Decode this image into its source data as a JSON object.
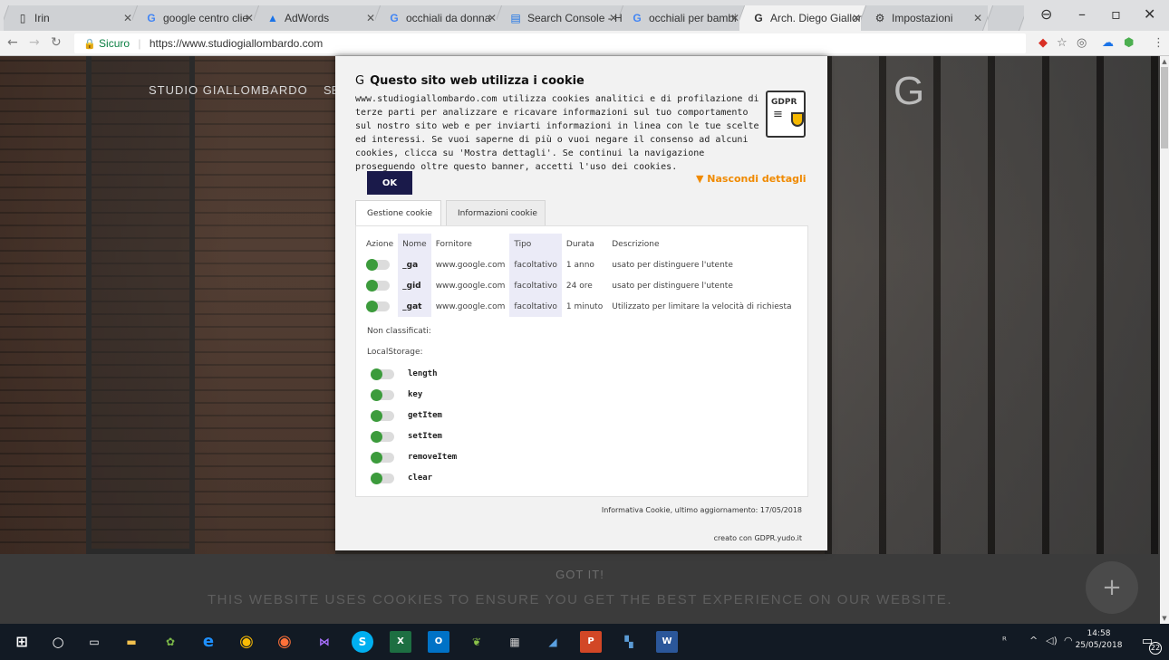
{
  "browser": {
    "tabs": [
      {
        "title": "Irin",
        "icon": "page-icon"
      },
      {
        "title": "google centro clie",
        "icon": "google-icon"
      },
      {
        "title": "AdWords",
        "icon": "adwords-icon"
      },
      {
        "title": "occhiali da donna",
        "icon": "google-icon"
      },
      {
        "title": "Search Console - H",
        "icon": "search-console-icon"
      },
      {
        "title": "occhiali per bambi",
        "icon": "google-icon"
      },
      {
        "title": "Arch. Diego Giallor",
        "icon": "g-icon",
        "active": true
      },
      {
        "title": "Impostazioni",
        "icon": "gear-icon"
      }
    ],
    "secure_label": "Sicuro",
    "url": "https://www.studiogiallombardo.com"
  },
  "site": {
    "brand": "STUDIO GIALLOMBARDO",
    "brand_fragment": "SE",
    "logo_letter": "G",
    "cookie_bar": {
      "got_it": "GOT IT!",
      "message": "THIS WEBSITE USES COOKIES TO ENSURE YOU GET THE BEST EXPERIENCE ON OUR WEBSITE."
    }
  },
  "gdpr": {
    "title": "Questo sito web utilizza i cookie",
    "logo_letter": "G",
    "body": "www.studiogiallombardo.com utilizza cookies analitici e di profilazione di terze parti per analizzare e ricavare informazioni sul tuo comportamento sul nostro sito web e per inviarti informazioni in linea con le tue scelte ed interessi. Se vuoi saperne di più o vuoi negare il consenso ad alcuni cookies, clicca su 'Mostra dettagli'. Se continui la navigazione proseguendo oltre questo banner, accetti l'uso dei cookies.",
    "badge_text": "GDPR",
    "ok_label": "OK",
    "hide_details": "▼ Nascondi dettagli",
    "tabs": [
      "Gestione cookie",
      "Informazioni cookie"
    ],
    "table": {
      "headers": [
        "Azione",
        "Nome",
        "Fornitore",
        "Tipo",
        "Durata",
        "Descrizione"
      ],
      "rows": [
        {
          "name": "_ga",
          "provider": "www.google.com",
          "type": "facoltativo",
          "duration": "1 anno",
          "description": "usato per distinguere l'utente"
        },
        {
          "name": "_gid",
          "provider": "www.google.com",
          "type": "facoltativo",
          "duration": "24 ore",
          "description": "usato per distinguere l'utente"
        },
        {
          "name": "_gat",
          "provider": "www.google.com",
          "type": "facoltativo",
          "duration": "1 minuto",
          "description": "Utilizzato per limitare la velocità di richiesta"
        }
      ]
    },
    "unclassified_label": "Non classificati:",
    "localstorage_label": "LocalStorage:",
    "localstorage_items": [
      "length",
      "key",
      "getItem",
      "setItem",
      "removeItem",
      "clear"
    ],
    "footer_info": "Informativa Cookie, ultimo aggiornamento: 17/05/2018",
    "footer_credit": "creato con GDPR.yudo.it"
  },
  "taskbar": {
    "time": "14:58",
    "date": "25/05/2018",
    "notifications": "22"
  }
}
